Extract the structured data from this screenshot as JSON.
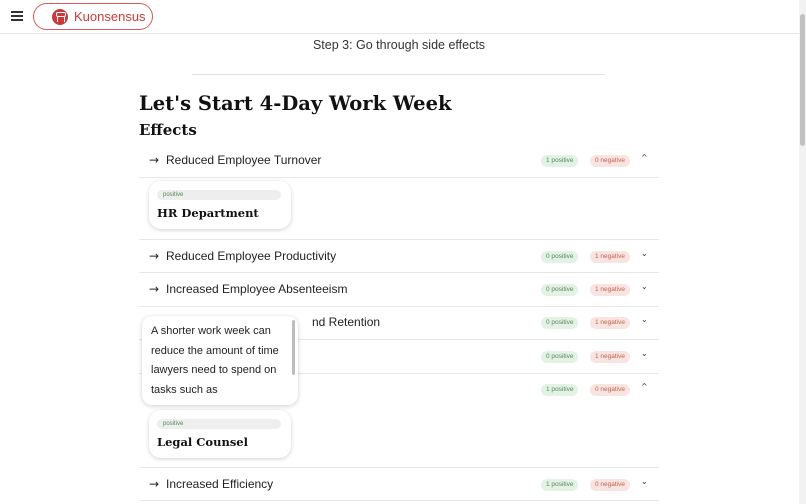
{
  "header": {
    "brand": "Kuonsensus",
    "menu_icon": "hamburger-menu-icon",
    "logo_icon": "kuonsensus-logo-icon",
    "accent_color": "#c73b3b"
  },
  "step_text": "Step 3: Go through side effects",
  "page_title": "Let's Start 4-Day Work Week",
  "section_title": "Effects",
  "effects": [
    {
      "label": "Reduced Employee Turnover",
      "positive": "1 positive",
      "negative": "0 negative",
      "expanded": true
    },
    {
      "label": "Reduced Employee Productivity",
      "positive": "0 positive",
      "negative": "1 negative",
      "expanded": false
    },
    {
      "label": "Increased Employee Absenteeism",
      "positive": "0 positive",
      "negative": "1 negative",
      "expanded": false
    },
    {
      "label": "nd Retention",
      "positive": "0 positive",
      "negative": "1 negative",
      "expanded": false
    },
    {
      "label": "",
      "positive": "0 positive",
      "negative": "1 negative",
      "expanded": false
    },
    {
      "label": "",
      "positive": "1 positive",
      "negative": "0 negative",
      "expanded": true
    },
    {
      "label": "Increased Efficiency",
      "positive": "1 positive",
      "negative": "0 negative",
      "expanded": false
    }
  ],
  "cards": [
    {
      "tag": "positive",
      "name": "HR Department"
    },
    {
      "tag": "positive",
      "name": "Legal Counsel"
    }
  ],
  "tooltip": {
    "text": "A shorter work week can reduce the amount of time lawyers need to spend on tasks such as"
  },
  "arrow_glyph": "→",
  "chevron_up": "^",
  "chevron_down": "⌄"
}
